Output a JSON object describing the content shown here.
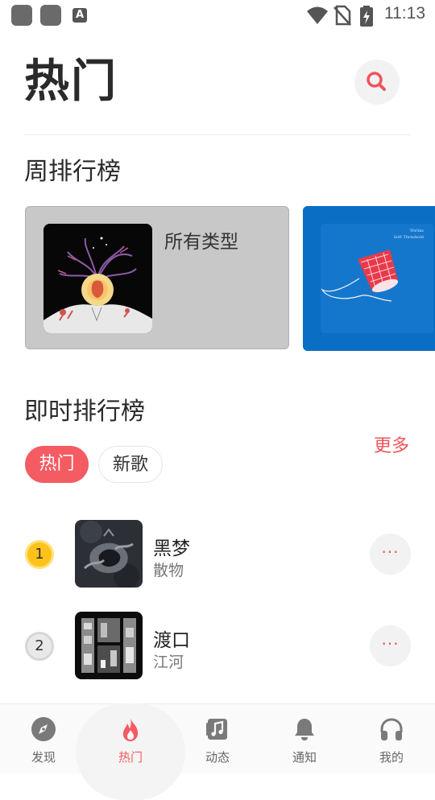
{
  "status_bar": {
    "time": "11:13",
    "notif_letter": "A"
  },
  "header": {
    "title": "热门"
  },
  "weekly_chart": {
    "title": "周排行榜",
    "cards": [
      {
        "label": "所有类型"
      }
    ]
  },
  "instant_chart": {
    "title": "即时排行榜",
    "more": "更多",
    "tabs": [
      {
        "label": "热门",
        "active": true
      },
      {
        "label": "新歌",
        "active": false
      }
    ],
    "songs": [
      {
        "rank": "1",
        "title": "黑梦",
        "artist": "散物"
      },
      {
        "rank": "2",
        "title": "渡口",
        "artist": "江河"
      }
    ],
    "more_icon": "···"
  },
  "bottom_nav": {
    "items": [
      {
        "label": "发现",
        "icon": "compass-icon"
      },
      {
        "label": "热门",
        "icon": "fire-icon",
        "active": true
      },
      {
        "label": "动态",
        "icon": "music-note-icon"
      },
      {
        "label": "通知",
        "icon": "bell-icon"
      },
      {
        "label": "我的",
        "icon": "headphones-icon"
      }
    ]
  },
  "colors": {
    "accent": "#f45b62",
    "card_gray": "#c8c8c8",
    "card_blue": "#0a6ec4",
    "rank_gold": "#ffc21a"
  }
}
